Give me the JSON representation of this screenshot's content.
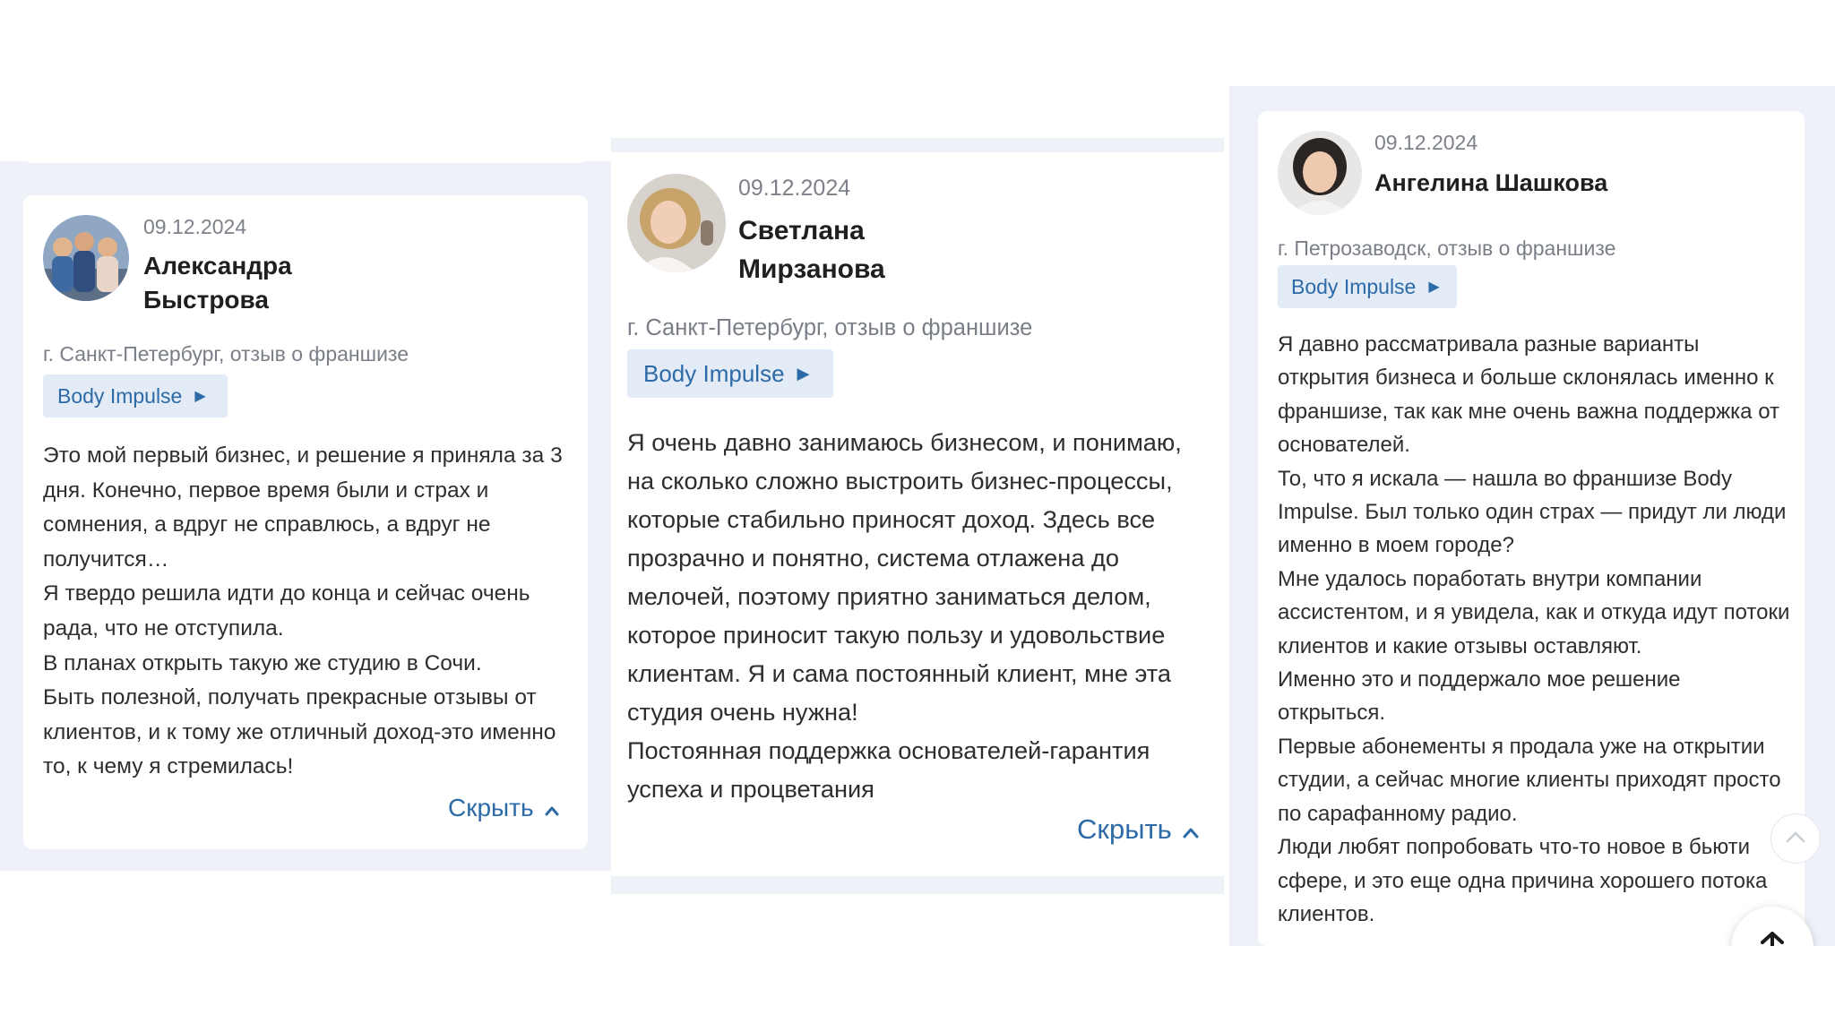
{
  "reviews": [
    {
      "date": "09.12.2024",
      "name_line1": "Александра",
      "name_line2": "Быстрова",
      "city": "г. Санкт-Петербург, отзыв о франшизе",
      "tag": "Body Impulse",
      "body": [
        "Это мой первый бизнес, и решение я приняла за 3 дня. Конечно, первое время были и страх и сомнения, а вдруг не справлюсь, а вдруг не получится…",
        "Я твердо решила идти до конца и сейчас очень рада, что не отступила.",
        "В планах открыть такую же студию в Сочи.",
        "Быть полезной, получать прекрасные отзывы от клиентов, и к тому же отличный доход-это именно то, к чему я стремилась!"
      ],
      "hide_label": "Скрыть"
    },
    {
      "date": "09.12.2024",
      "name_line1": "Светлана",
      "name_line2": "Мирзанова",
      "city": "г. Санкт-Петербург, отзыв о франшизе",
      "tag": "Body Impulse",
      "body": [
        "Я очень давно занимаюсь бизнесом, и понимаю, на сколько сложно выстроить бизнес-процессы, которые стабильно приносят доход. Здесь все прозрачно и понятно, система отлажена до мелочей, поэтому приятно заниматься делом, которое приносит такую пользу и удовольствие клиентам. Я и сама постоянный клиент, мне эта студия очень нужна!",
        "Постоянная поддержка основателей-гарантия успеха и процветания"
      ],
      "hide_label": "Скрыть"
    },
    {
      "date": "09.12.2024",
      "name_line1": "Ангелина Шашкова",
      "city": "г. Петрозаводск, отзыв о франшизе",
      "tag": "Body Impulse",
      "body": [
        "Я давно рассматривала разные варианты открытия бизнеса и больше склонялась именно к франшизе, так как мне очень важна поддержка от основателей.",
        "То, что я искала — нашла во франшизе Body Impulse. Был только один страх — придут ли люди именно в моем городе?",
        "Мне удалось поработать внутри компании ассистентом, и я увидела, как и откуда идут потоки клиентов и какие отзывы оставляют.",
        "Именно это и поддержало мое решение открыться.",
        "Первые абонементы я продала уже на открытии студии, а сейчас многие клиенты приходят просто по сарафанному радио.",
        "Люди любят попробовать что-то новое в бьюти сфере, и это еще одна причина хорошего потока клиентов."
      ]
    }
  ],
  "icons": {
    "tag_arrow": "caret-right-icon",
    "hide_arrow": "chevron-up-icon",
    "scroll_top": "arrow-up-icon"
  },
  "colors": {
    "accent": "#2c6aa8",
    "panel": "#eef2f8",
    "tag_bg": "#e3ebf6"
  }
}
